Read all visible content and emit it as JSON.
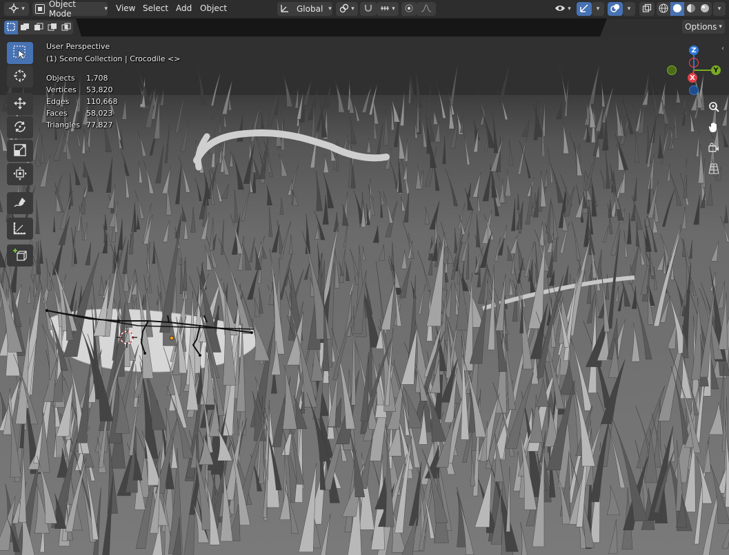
{
  "header": {
    "mode_label": "Object Mode",
    "menus": [
      "View",
      "Select",
      "Add",
      "Object"
    ],
    "orientation_label": "Global"
  },
  "options_label": "Options",
  "overlay": {
    "perspective": "User Perspective",
    "collection": "(1) Scene Collection | Crocodile <>"
  },
  "stats": [
    {
      "label": "Objects",
      "value": "1,708"
    },
    {
      "label": "Vertices",
      "value": "53,820"
    },
    {
      "label": "Edges",
      "value": "110,668"
    },
    {
      "label": "Faces",
      "value": "58,023"
    },
    {
      "label": "Triangles",
      "value": "77,827"
    }
  ],
  "gizmo": {
    "x": "X",
    "y": "Y",
    "z": "Z"
  },
  "colors": {
    "accent": "#4772b3",
    "axis_x": "#e0404a",
    "axis_y": "#7aab20",
    "axis_z": "#2f78d8"
  }
}
